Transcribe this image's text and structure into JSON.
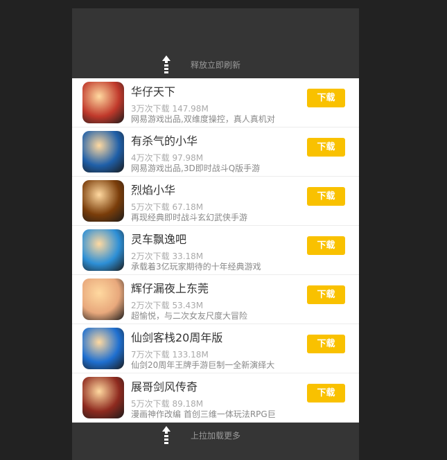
{
  "refresh": {
    "text": "释放立即刷新",
    "icon": "arrow-up-icon"
  },
  "load_more": {
    "text": "上拉加载更多",
    "icon": "arrow-up-icon"
  },
  "apps": [
    {
      "name": "华仔天下",
      "meta": "3万次下载 147.98M",
      "desc": "网易游戏出品,双维度操控，真人真机对",
      "button": "下载",
      "icon": "warrior-avatar-icon",
      "color": "#c0392b"
    },
    {
      "name": "有杀气的小华",
      "meta": "4万次下载 97.98M",
      "desc": "网易游戏出品,3D即时战斗Q版手游",
      "button": "下载",
      "icon": "cartoon-hero-icon",
      "color": "#1f5fa8"
    },
    {
      "name": "烈焰小华",
      "meta": "5万次下载 67.18M",
      "desc": "再现经典即时战斗玄幻武侠手游",
      "button": "下载",
      "icon": "flame-emblem-icon",
      "color": "#7a3d0a"
    },
    {
      "name": "灵车飘逸吧",
      "meta": "2万次下载 33.18M",
      "desc": "承载着3亿玩家期待的十年经典游戏",
      "button": "下载",
      "icon": "kart-racer-icon",
      "color": "#2d8fd6"
    },
    {
      "name": "辉仔漏夜上东莞",
      "meta": "2万次下载 53.43M",
      "desc": "超愉悦，与二次女友尺度大冒险",
      "button": "下载",
      "icon": "anime-girl-icon",
      "color": "#e8a87c"
    },
    {
      "name": "仙剑客栈20周年版",
      "meta": "7万次下载 133.18M",
      "desc": "仙剑20周年王牌手游巨制一全新演绎大",
      "button": "下载",
      "icon": "sword-logo-icon",
      "color": "#1e6fd0"
    },
    {
      "name": "展哥剑风传奇",
      "meta": "5万次下载 89.18M",
      "desc": "漫画神作改编 首创三维一体玩法RPG巨",
      "button": "下载",
      "icon": "monkey-king-icon",
      "color": "#8e2a1f"
    }
  ]
}
